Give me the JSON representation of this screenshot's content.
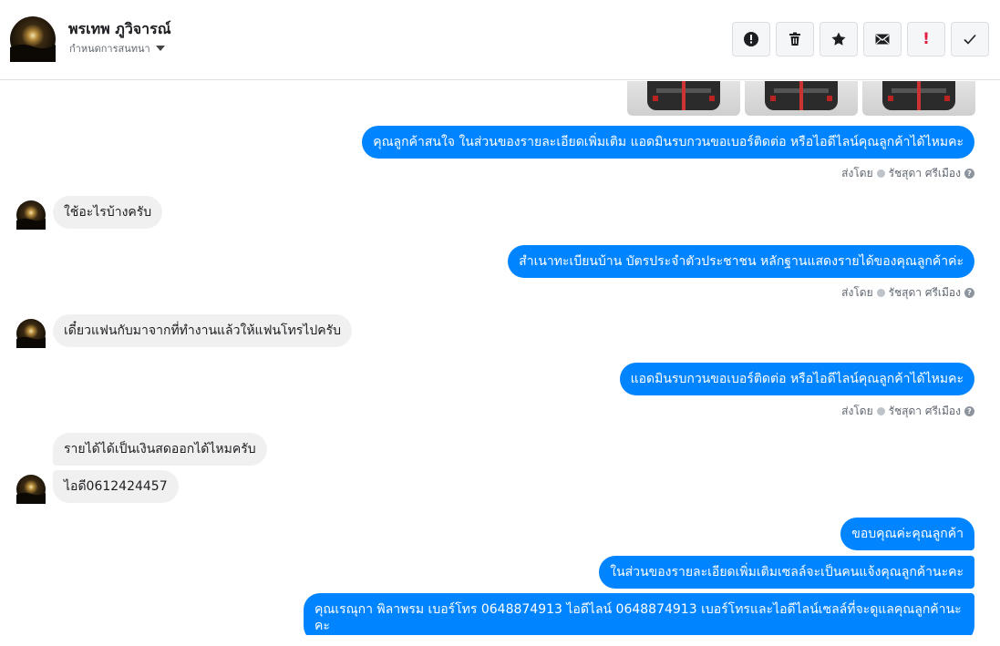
{
  "header": {
    "name": "พรเทพ ภูวิจารณ์",
    "subtitle": "กำหนดการสนทนา",
    "toolbar": [
      {
        "icon": "alert-circle-icon"
      },
      {
        "icon": "trash-icon"
      },
      {
        "icon": "star-icon"
      },
      {
        "icon": "envelope-icon"
      },
      {
        "icon": "exclamation-icon",
        "label": "!"
      },
      {
        "icon": "check-icon"
      }
    ]
  },
  "colors": {
    "outgoing": "#0084ff",
    "incoming": "#f1f0f0",
    "alert_red": "#e41e3f"
  },
  "messages": {
    "m1": "คุณลูกค้าสนใจ ในส่วนของรายละเอียดเพิ่มเติม แอดมินรบกวนขอเบอร์ติดต่อ หรือไอดีไลน์คุณลูกค้าได้ไหมคะ",
    "m2": "ใช้อะไรบ้างครับ",
    "m3": "สำเนาทะเบียนบ้าน บัตรประจำตัวประชาชน หลักฐานแสดงรายได้ของคุณลูกค้าค่ะ",
    "m4": "เดี๋ยวแฟนกับมาจากที่ทำงานแล้วให้แฟนโทรไปครับ",
    "m5": "แอดมินรบกวนขอเบอร์ติดต่อ หรือไอดีไลน์คุณลูกค้าได้ไหมคะ",
    "m6": "รายได้ได้เป็นเงินสดออกได้ไหมครับ",
    "m7": "ไอดี0612424457",
    "m8": "ขอบคุณค่ะคุณลูกค้า",
    "m9": "ในส่วนของรายละเอียดเพิ่มเติมเซลล์จะเป็นคนแจ้งคุณลูกค้านะคะ",
    "m10": "คุณเรณุกา พิลาพรม        เบอร์โทร 0648874913  ไอดีไลน์ 0648874913  เบอร์โทรและไอดีไลน์เซลล์ที่จะดูแลคุณลูกค้านะคะ"
  },
  "sent_by": {
    "prefix": "ส่งโดย",
    "agent": "รัชสุดา ศรีเมือง",
    "help": "?"
  }
}
